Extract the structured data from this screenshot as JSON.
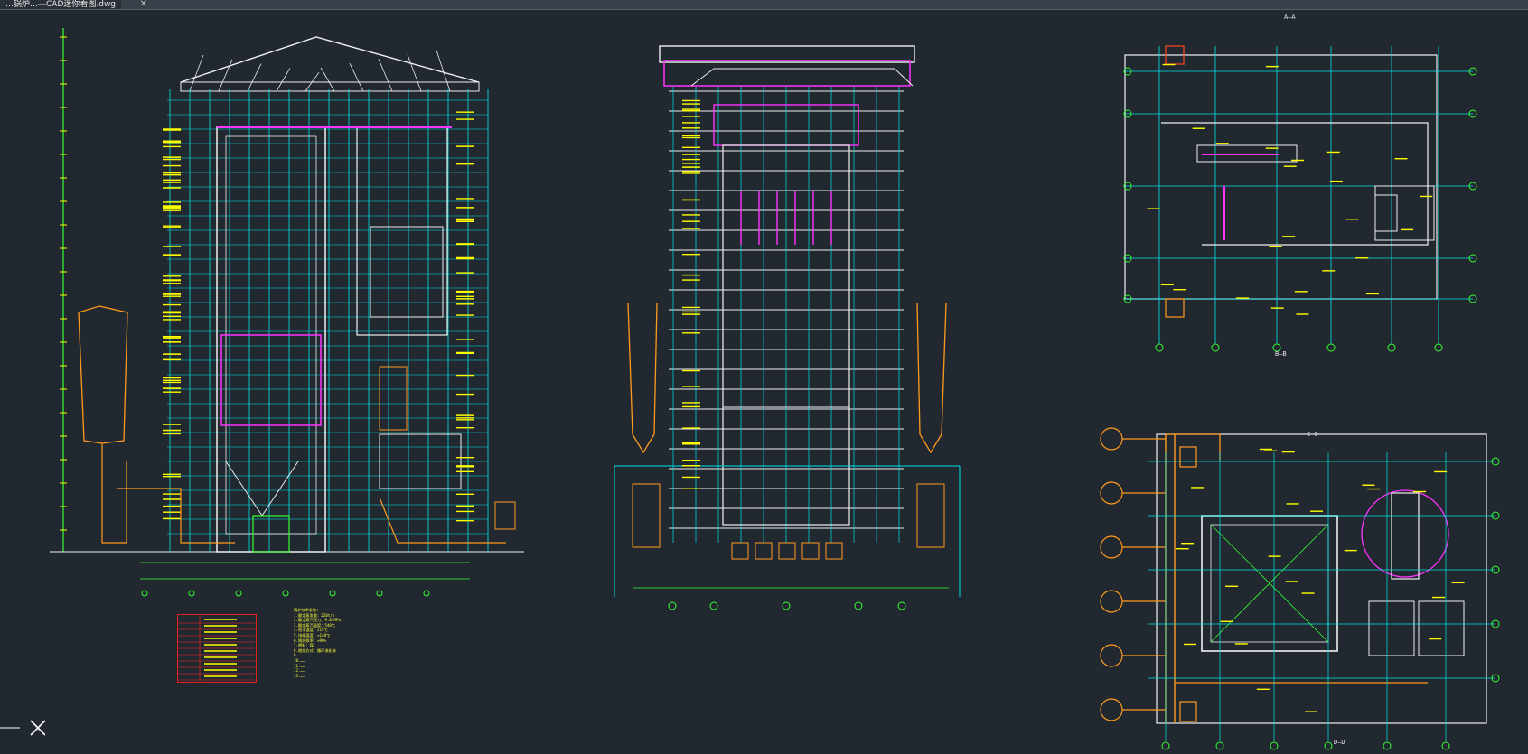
{
  "window": {
    "tab_title": "…锅炉…—CAD迷你看图.dwg",
    "tab_close_symbol": "✕"
  },
  "views": {
    "aa_title": "A—A",
    "bb_title": "B—B",
    "cc_title": "C—C",
    "dd_title": "D—D"
  },
  "notes": {
    "heading": "锅炉技术参数:",
    "lines": [
      "1.额定蒸发量：220t/h",
      "2.额定蒸汽压力：9.81MPa",
      "3.额定蒸汽温度：540℃",
      "4.给水温度：215℃",
      "5.排烟温度：≈140℃",
      "6.锅炉效率：≈90%",
      "7.燃料：煤",
      "8.燃烧方式：循环流化床",
      "9.……",
      "10.……",
      "11.……",
      "12.……",
      "13.……"
    ]
  },
  "colors": {
    "background": "#212830",
    "cyan": "#00e6e6",
    "white": "#f0f0f0",
    "yellow": "#ffff00",
    "green": "#33ff33",
    "magenta": "#ff33ff",
    "orange": "#ff9a1f",
    "red": "#ff2020"
  }
}
